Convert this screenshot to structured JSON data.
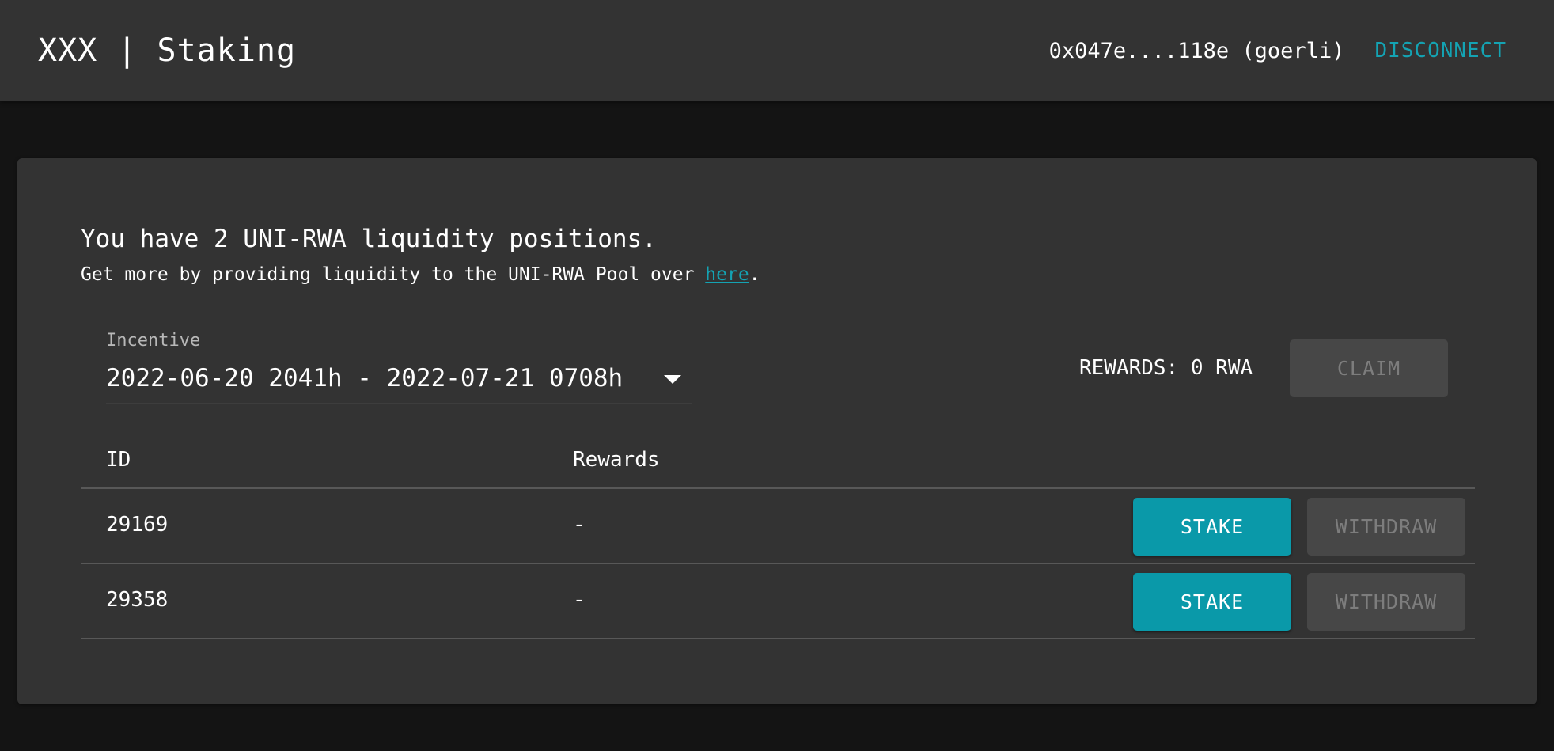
{
  "header": {
    "title": "XXX | Staking",
    "wallet_address": "0x047e....118e (goerli)",
    "disconnect_label": "DISCONNECT"
  },
  "card": {
    "headline": "You have 2 UNI-RWA liquidity positions.",
    "subline_prefix": "Get more by providing liquidity to the UNI-RWA Pool over ",
    "subline_link": "here",
    "subline_suffix": ".",
    "incentive": {
      "label": "Incentive",
      "selected": "2022-06-20 2041h - 2022-07-21 0708h"
    },
    "rewards_label": "REWARDS: 0 RWA",
    "claim_label": "CLAIM"
  },
  "table": {
    "columns": [
      "ID",
      "Rewards"
    ],
    "rows": [
      {
        "id": "29169",
        "rewards": "-",
        "stake_label": "STAKE",
        "withdraw_label": "WITHDRAW"
      },
      {
        "id": "29358",
        "rewards": "-",
        "stake_label": "STAKE",
        "withdraw_label": "WITHDRAW"
      }
    ]
  },
  "colors": {
    "accent": "#0a99a9",
    "link": "#14a3b3",
    "surface": "#333333",
    "background": "#141414"
  }
}
